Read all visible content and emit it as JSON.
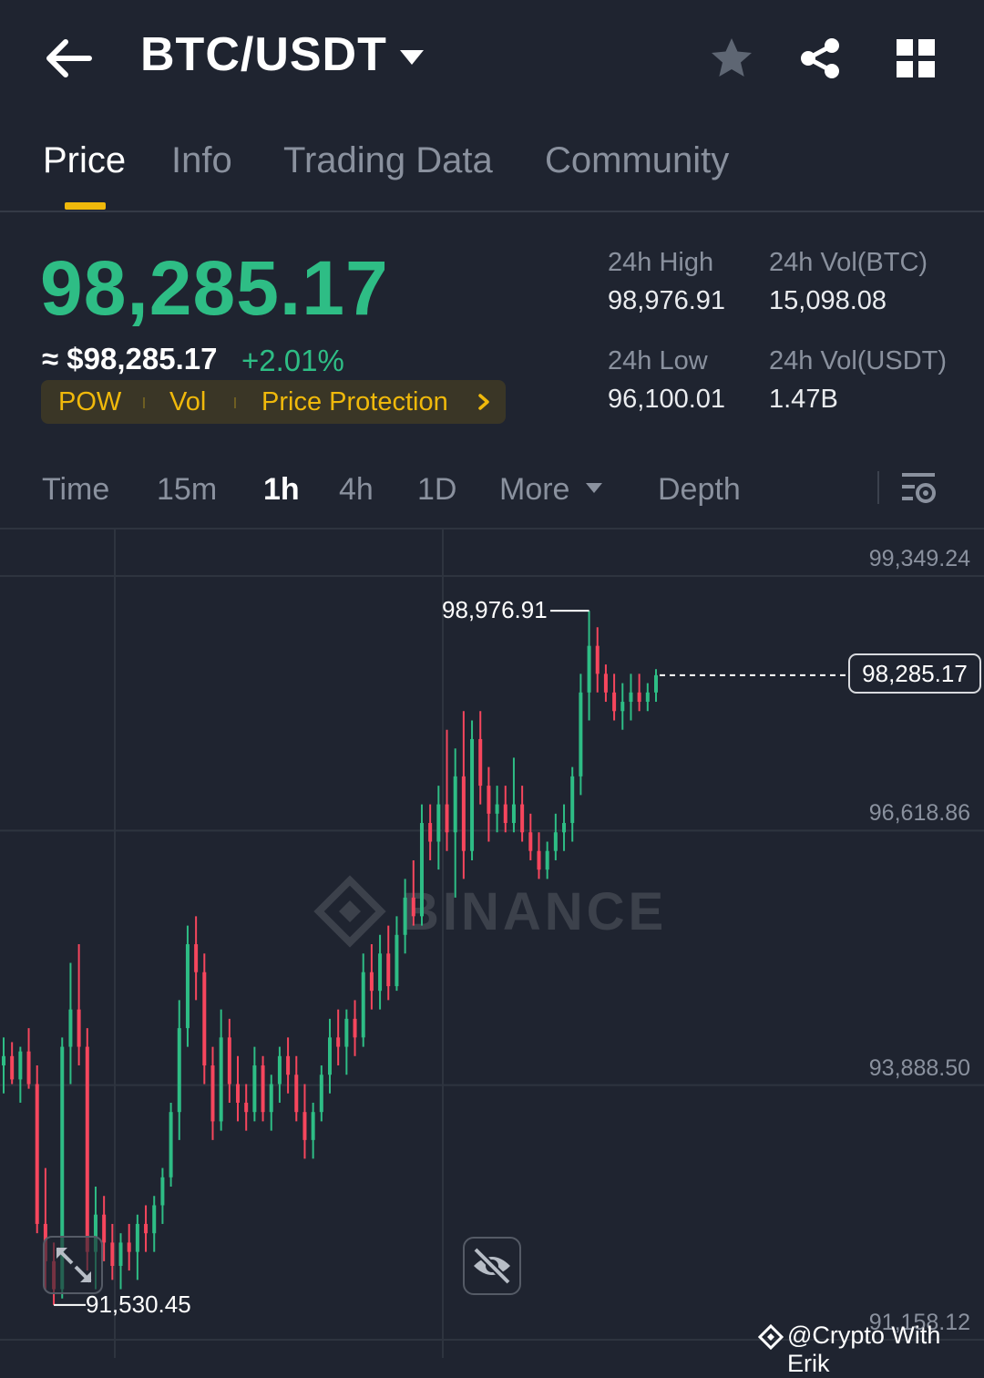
{
  "header": {
    "pair": "BTC/USDT"
  },
  "tabs": [
    {
      "label": "Price",
      "active": true
    },
    {
      "label": "Info",
      "active": false
    },
    {
      "label": "Trading Data",
      "active": false
    },
    {
      "label": "Community",
      "active": false
    }
  ],
  "ticker": {
    "last_price": "98,285.17",
    "fiat_price": "≈ $98,285.17",
    "change_pct": "+2.01%",
    "tags": [
      "POW",
      "Vol",
      "Price Protection"
    ],
    "high_label": "24h High",
    "high_value": "98,976.91",
    "low_label": "24h Low",
    "low_value": "96,100.01",
    "vol_btc_label": "24h Vol(BTC)",
    "vol_btc_value": "15,098.08",
    "vol_usdt_label": "24h Vol(USDT)",
    "vol_usdt_value": "1.47B"
  },
  "intervals": [
    {
      "label": "Time",
      "active": false
    },
    {
      "label": "15m",
      "active": false
    },
    {
      "label": "1h",
      "active": true
    },
    {
      "label": "4h",
      "active": false
    },
    {
      "label": "1D",
      "active": false
    },
    {
      "label": "More",
      "active": false
    },
    {
      "label": "Depth",
      "active": false
    }
  ],
  "chart": {
    "price_labels": [
      "99,349.24",
      "96,618.86",
      "93,888.50",
      "91,158.12"
    ],
    "high_marker": "98,976.91",
    "low_marker": "91,530.45",
    "current_price": "98,285.17",
    "watermark": "BINANCE"
  },
  "chart_data": {
    "type": "candlestick",
    "interval": "1h",
    "y_ticks": [
      99349.24,
      96618.86,
      93888.5,
      91158.12
    ],
    "ylim": [
      91158.12,
      99349.24
    ],
    "high": 98976.91,
    "low": 91530.45,
    "last": 98285.17,
    "up_color": "#2ebd85",
    "down_color": "#f6465d",
    "candles": [
      {
        "o": 94100,
        "h": 94400,
        "l": 93800,
        "c": 94200
      },
      {
        "o": 94200,
        "h": 94350,
        "l": 93900,
        "c": 93950
      },
      {
        "o": 93950,
        "h": 94300,
        "l": 93700,
        "c": 94250
      },
      {
        "o": 94250,
        "h": 94500,
        "l": 93850,
        "c": 93900
      },
      {
        "o": 93900,
        "h": 94100,
        "l": 92300,
        "c": 92400
      },
      {
        "o": 92400,
        "h": 93000,
        "l": 91700,
        "c": 92000
      },
      {
        "o": 92000,
        "h": 92200,
        "l": 91530.45,
        "c": 91700
      },
      {
        "o": 91700,
        "h": 94400,
        "l": 91600,
        "c": 94300
      },
      {
        "o": 94300,
        "h": 95200,
        "l": 93900,
        "c": 94700
      },
      {
        "o": 94700,
        "h": 95400,
        "l": 94100,
        "c": 94300
      },
      {
        "o": 94300,
        "h": 94500,
        "l": 91900,
        "c": 92100
      },
      {
        "o": 92100,
        "h": 92800,
        "l": 91700,
        "c": 92500
      },
      {
        "o": 92500,
        "h": 92700,
        "l": 92000,
        "c": 92200
      },
      {
        "o": 92200,
        "h": 92400,
        "l": 91800,
        "c": 91950
      },
      {
        "o": 91950,
        "h": 92300,
        "l": 91700,
        "c": 92200
      },
      {
        "o": 92200,
        "h": 92400,
        "l": 91900,
        "c": 92100
      },
      {
        "o": 92100,
        "h": 92500,
        "l": 91800,
        "c": 92400
      },
      {
        "o": 92400,
        "h": 92600,
        "l": 92100,
        "c": 92300
      },
      {
        "o": 92300,
        "h": 92700,
        "l": 92100,
        "c": 92600
      },
      {
        "o": 92600,
        "h": 93000,
        "l": 92400,
        "c": 92900
      },
      {
        "o": 92900,
        "h": 93700,
        "l": 92800,
        "c": 93600
      },
      {
        "o": 93600,
        "h": 94800,
        "l": 93300,
        "c": 94500
      },
      {
        "o": 94500,
        "h": 95600,
        "l": 94300,
        "c": 95400
      },
      {
        "o": 95400,
        "h": 95700,
        "l": 94800,
        "c": 95100
      },
      {
        "o": 95100,
        "h": 95300,
        "l": 93900,
        "c": 94100
      },
      {
        "o": 94100,
        "h": 94300,
        "l": 93300,
        "c": 93500
      },
      {
        "o": 93500,
        "h": 94700,
        "l": 93400,
        "c": 94400
      },
      {
        "o": 94400,
        "h": 94600,
        "l": 93700,
        "c": 93900
      },
      {
        "o": 93900,
        "h": 94200,
        "l": 93500,
        "c": 93700
      },
      {
        "o": 93700,
        "h": 93900,
        "l": 93400,
        "c": 93600
      },
      {
        "o": 93600,
        "h": 94300,
        "l": 93500,
        "c": 94100
      },
      {
        "o": 94100,
        "h": 94200,
        "l": 93500,
        "c": 93600
      },
      {
        "o": 93600,
        "h": 94000,
        "l": 93400,
        "c": 93900
      },
      {
        "o": 93900,
        "h": 94300,
        "l": 93700,
        "c": 94200
      },
      {
        "o": 94200,
        "h": 94400,
        "l": 93800,
        "c": 94000
      },
      {
        "o": 94000,
        "h": 94200,
        "l": 93500,
        "c": 93600
      },
      {
        "o": 93600,
        "h": 93900,
        "l": 93100,
        "c": 93300
      },
      {
        "o": 93300,
        "h": 93700,
        "l": 93100,
        "c": 93600
      },
      {
        "o": 93600,
        "h": 94100,
        "l": 93500,
        "c": 94000
      },
      {
        "o": 94000,
        "h": 94600,
        "l": 93800,
        "c": 94400
      },
      {
        "o": 94400,
        "h": 94700,
        "l": 94100,
        "c": 94300
      },
      {
        "o": 94300,
        "h": 94700,
        "l": 94000,
        "c": 94600
      },
      {
        "o": 94600,
        "h": 94800,
        "l": 94200,
        "c": 94400
      },
      {
        "o": 94400,
        "h": 95300,
        "l": 94300,
        "c": 95100
      },
      {
        "o": 95100,
        "h": 95400,
        "l": 94700,
        "c": 94900
      },
      {
        "o": 94900,
        "h": 95500,
        "l": 94700,
        "c": 95300
      },
      {
        "o": 95300,
        "h": 95600,
        "l": 94800,
        "c": 94950
      },
      {
        "o": 94950,
        "h": 95700,
        "l": 94900,
        "c": 95500
      },
      {
        "o": 95500,
        "h": 96100,
        "l": 95300,
        "c": 95900
      },
      {
        "o": 95900,
        "h": 96300,
        "l": 95600,
        "c": 95700
      },
      {
        "o": 95700,
        "h": 96900,
        "l": 95600,
        "c": 96700
      },
      {
        "o": 96700,
        "h": 96900,
        "l": 96300,
        "c": 96500
      },
      {
        "o": 96500,
        "h": 97100,
        "l": 96200,
        "c": 96900
      },
      {
        "o": 96900,
        "h": 97700,
        "l": 96400,
        "c": 96600
      },
      {
        "o": 96600,
        "h": 97500,
        "l": 95900,
        "c": 97200
      },
      {
        "o": 97200,
        "h": 97900,
        "l": 96100,
        "c": 96400
      },
      {
        "o": 96400,
        "h": 97800,
        "l": 96300,
        "c": 97600
      },
      {
        "o": 97600,
        "h": 97900,
        "l": 96900,
        "c": 97100
      },
      {
        "o": 97100,
        "h": 97300,
        "l": 96500,
        "c": 96800
      },
      {
        "o": 96800,
        "h": 97100,
        "l": 96600,
        "c": 96900
      },
      {
        "o": 96900,
        "h": 97100,
        "l": 96600,
        "c": 96700
      },
      {
        "o": 96700,
        "h": 97400,
        "l": 96600,
        "c": 96900
      },
      {
        "o": 96900,
        "h": 97100,
        "l": 96500,
        "c": 96600
      },
      {
        "o": 96600,
        "h": 96800,
        "l": 96300,
        "c": 96400
      },
      {
        "o": 96400,
        "h": 96600,
        "l": 96100.01,
        "c": 96200
      },
      {
        "o": 96200,
        "h": 96500,
        "l": 96100,
        "c": 96400
      },
      {
        "o": 96400,
        "h": 96800,
        "l": 96300,
        "c": 96600
      },
      {
        "o": 96600,
        "h": 96900,
        "l": 96400,
        "c": 96700
      },
      {
        "o": 96700,
        "h": 97300,
        "l": 96500,
        "c": 97200
      },
      {
        "o": 97200,
        "h": 98300,
        "l": 97000,
        "c": 98100
      },
      {
        "o": 98100,
        "h": 98976.91,
        "l": 97800,
        "c": 98600
      },
      {
        "o": 98600,
        "h": 98800,
        "l": 98100,
        "c": 98300
      },
      {
        "o": 98300,
        "h": 98400,
        "l": 98000,
        "c": 98100
      },
      {
        "o": 98100,
        "h": 98300,
        "l": 97800,
        "c": 97900
      },
      {
        "o": 97900,
        "h": 98200,
        "l": 97700,
        "c": 98000
      },
      {
        "o": 98000,
        "h": 98300,
        "l": 97800,
        "c": 98100
      },
      {
        "o": 98100,
        "h": 98300,
        "l": 97900,
        "c": 98000
      },
      {
        "o": 98000,
        "h": 98200,
        "l": 97900,
        "c": 98100
      },
      {
        "o": 98100,
        "h": 98350,
        "l": 98000,
        "c": 98285.17
      }
    ]
  }
}
